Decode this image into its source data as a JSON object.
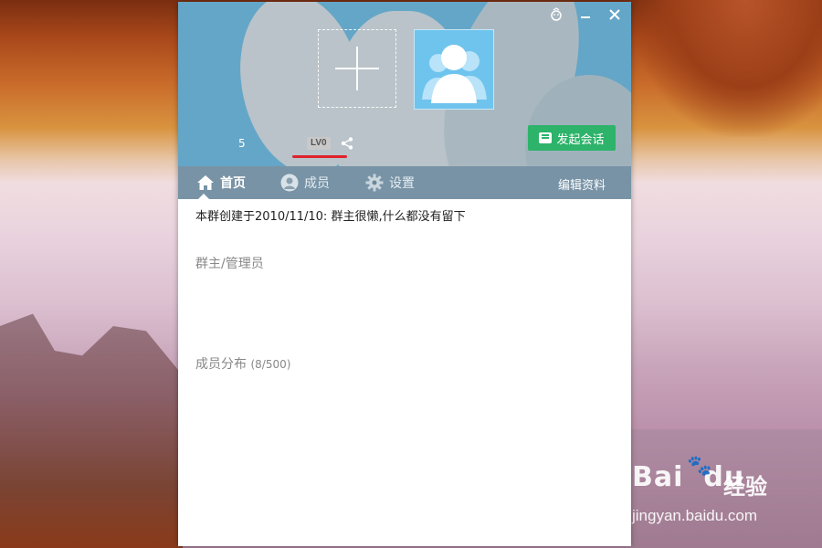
{
  "window": {
    "group_name_fragment": "5",
    "level": "LV0",
    "start_chat_label": "发起会话",
    "controls": [
      "skin-icon",
      "minimize-icon",
      "close-icon"
    ]
  },
  "tabs": [
    {
      "label": "首页",
      "icon": "home-icon",
      "active": true
    },
    {
      "label": "成员",
      "icon": "user-icon",
      "active": false
    },
    {
      "label": "设置",
      "icon": "gear-icon",
      "active": false
    }
  ],
  "edit_profile_label": "编辑资料",
  "content": {
    "intro": "本群创建于2010/11/10:  群主很懒,什么都没有留下",
    "admins_label": "群主/管理员",
    "distribution_label": "成员分布",
    "distribution_count": "(8/500)"
  },
  "watermark": {
    "brand": "Bai",
    "brand_suffix": "du",
    "brand_cn": "经验",
    "url": "jingyan.baidu.com"
  },
  "colors": {
    "accent_green": "#2db36a",
    "banner_blue": "#64a6c8",
    "highlight_red": "#e0232c"
  }
}
